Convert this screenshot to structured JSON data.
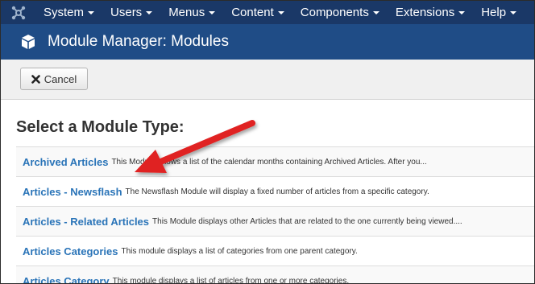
{
  "navbar": {
    "logo_icon": "joomla-logo-icon",
    "menu": [
      {
        "label": "System"
      },
      {
        "label": "Users"
      },
      {
        "label": "Menus"
      },
      {
        "label": "Content"
      },
      {
        "label": "Components"
      },
      {
        "label": "Extensions"
      },
      {
        "label": "Help"
      }
    ],
    "background": "#1a3867"
  },
  "titlebar": {
    "icon": "cube-icon",
    "title": "Module Manager: Modules",
    "background": "#1f4c86"
  },
  "toolbar": {
    "cancel_label": "Cancel",
    "cancel_icon": "close-icon"
  },
  "main": {
    "heading": "Select a Module Type:",
    "modules": [
      {
        "name": "Archived Articles",
        "description": "This Module shows a list of the calendar months containing Archived Articles. After you..."
      },
      {
        "name": "Articles - Newsflash",
        "description": "The Newsflash Module will display a fixed number of articles from a specific category."
      },
      {
        "name": "Articles - Related Articles",
        "description": "This Module displays other Articles that are related to the one currently being viewed...."
      },
      {
        "name": "Articles Categories",
        "description": "This module displays a list of categories from one parent category."
      },
      {
        "name": "Articles Category",
        "description": "This module displays a list of articles from one or more categories."
      }
    ],
    "link_color": "#2a74b8"
  },
  "annotation": {
    "arrow_icon": "red-arrow-pointer",
    "color": "#e02020"
  }
}
